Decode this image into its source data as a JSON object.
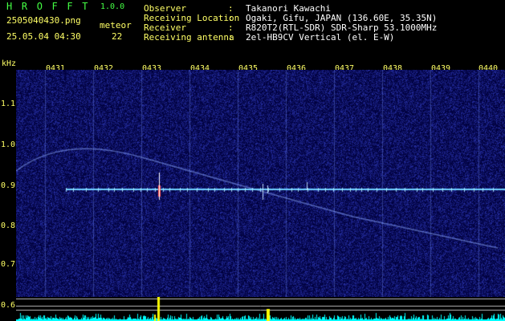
{
  "header": {
    "app_name": "H R O F F T",
    "version": "1.0.0",
    "filename": "2505040430.png",
    "meteor_label": "meteor",
    "datetime": "25.05.04 04:30",
    "meteor_count": "22",
    "info": [
      {
        "label": "Observer",
        "value": "Takanori Kawachi"
      },
      {
        "label": "Receiving Location",
        "value": "Ogaki, Gifu, JAPAN (136.60E, 35.35N)"
      },
      {
        "label": "Receiver",
        "value": "R820T2(RTL-SDR) SDR-Sharp 53.1000MHz"
      },
      {
        "label": "Receiving antenna",
        "value": "2el-HB9CV Vertical (el. E-W)"
      }
    ],
    "colon": ":"
  },
  "spectrogram": {
    "y_unit": "kHz",
    "time_ticks": [
      "0431",
      "0432",
      "0433",
      "0434",
      "0435",
      "0436",
      "0437",
      "0438",
      "0439",
      "0440"
    ],
    "freq_ticks": [
      "1.1",
      "1.0",
      "0.9",
      "0.8",
      "0.7",
      "0.6"
    ],
    "colors": {
      "background": "#00005a",
      "carrier": "#6fd0ff",
      "echo": "#ff4a4a",
      "strip": "#00ffff",
      "strip_peak": "#ffff00"
    }
  }
}
